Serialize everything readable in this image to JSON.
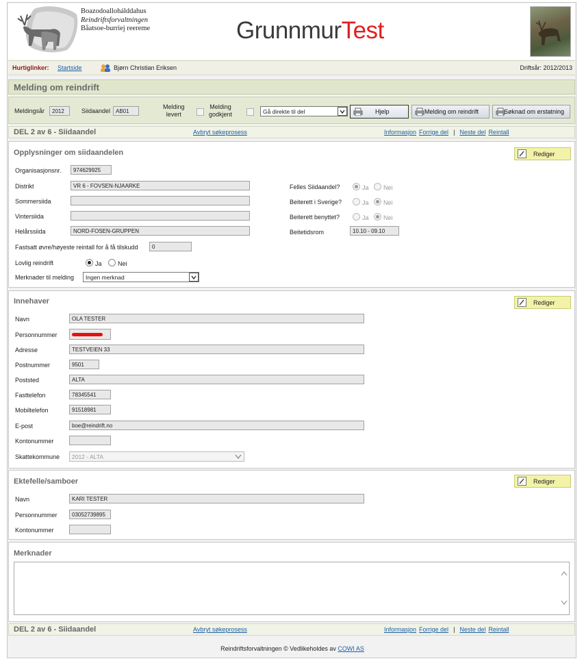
{
  "header": {
    "org_line1": "Boazodoallohálddahus",
    "org_line2": "Reindriftsforvaltningen",
    "org_line3": "Båatsoe-burriej reereme",
    "app_name_part1": "Grunnmur",
    "app_name_part2": "Test"
  },
  "quicklinks": {
    "label": "Hurtiglinker:",
    "start_link": "Startside",
    "user": "Bjørn Christian Eriksen",
    "operating_year": "Driftsår: 2012/2013"
  },
  "page_title": "Melding om reindrift",
  "toolbar": {
    "year_label": "Meldingsår",
    "year_value": "2012",
    "share_label": "Siidaandel",
    "share_value": "AB01",
    "delivered_label_1": "Melding",
    "delivered_label_2": "levert",
    "approved_label_1": "Melding",
    "approved_label_2": "godkjent",
    "goto_select": "Gå direkte til del",
    "help_button": "Hjelp",
    "report_button": "Melding om reindrift",
    "compensation_button": "Søknad om erstatning"
  },
  "nav": {
    "heading": "DEL 2 av 6 - Siidaandel",
    "abort": "Avbryt søkeprosess",
    "info": "Informasjon",
    "prev": "Forrige del",
    "sep": "|",
    "next": "Neste del",
    "count": "Reintall"
  },
  "section_siida": {
    "title": "Opplysninger om siidaandelen",
    "edit": "Rediger",
    "org_label": "Organisasjonsnr.",
    "org_value": "974629925",
    "district_label": "Distrikt",
    "district_value": "VR 6 - FOVSEN-NJAARKE",
    "summer_label": "Sommersiida",
    "summer_value": "",
    "winter_label": "Vintersiida",
    "winter_value": "",
    "yearround_label": "Helårssiida",
    "yearround_value": "NORD-FOSEN-GRUPPEN",
    "limit_label": "Fastsatt øvre/høyeste reintall for å få tilskudd",
    "limit_value": "0",
    "legal_label": "Lovlig reindrift",
    "yes": "Ja",
    "no": "Nei",
    "remarks_label": "Merknader til melding",
    "remarks_value": "Ingen merknad",
    "common_label": "Felles Siidaandel?",
    "sweden_label": "Beiterett i Sverige?",
    "used_label": "Beiterett benyttet?",
    "period_label": "Beitetidsrom",
    "period_value": "10.10 - 09.10"
  },
  "section_owner": {
    "title": "Innehaver",
    "edit": "Rediger",
    "name_label": "Navn",
    "name_value": "OLA TESTER",
    "pnr_label": "Personnummer",
    "address_label": "Adresse",
    "address_value": "TESTVEIEN 33",
    "zip_label": "Postnummer",
    "zip_value": "9501",
    "city_label": "Poststed",
    "city_value": "ALTA",
    "phone_label": "Fasttelefon",
    "phone_value": "78345541",
    "mobile_label": "Mobiltelefon",
    "mobile_value": "91518981",
    "email_label": "E-post",
    "email_value": "boe@reindrift.no",
    "account_label": "Kontonummer",
    "account_value": "",
    "tax_label": "Skattekommune",
    "tax_value": "2012 - ALTA"
  },
  "section_spouse": {
    "title": "Ektefelle/samboer",
    "edit": "Rediger",
    "name_label": "Navn",
    "name_value": "KARI TESTER",
    "pnr_label": "Personnummer",
    "pnr_value": "03052739895",
    "account_label": "Kontonummer",
    "account_value": ""
  },
  "section_notes": {
    "title": "Merknader"
  },
  "footer": {
    "text": "Reindriftsforvaltningen © Vedlikeholdes av ",
    "link": "COWI AS"
  }
}
